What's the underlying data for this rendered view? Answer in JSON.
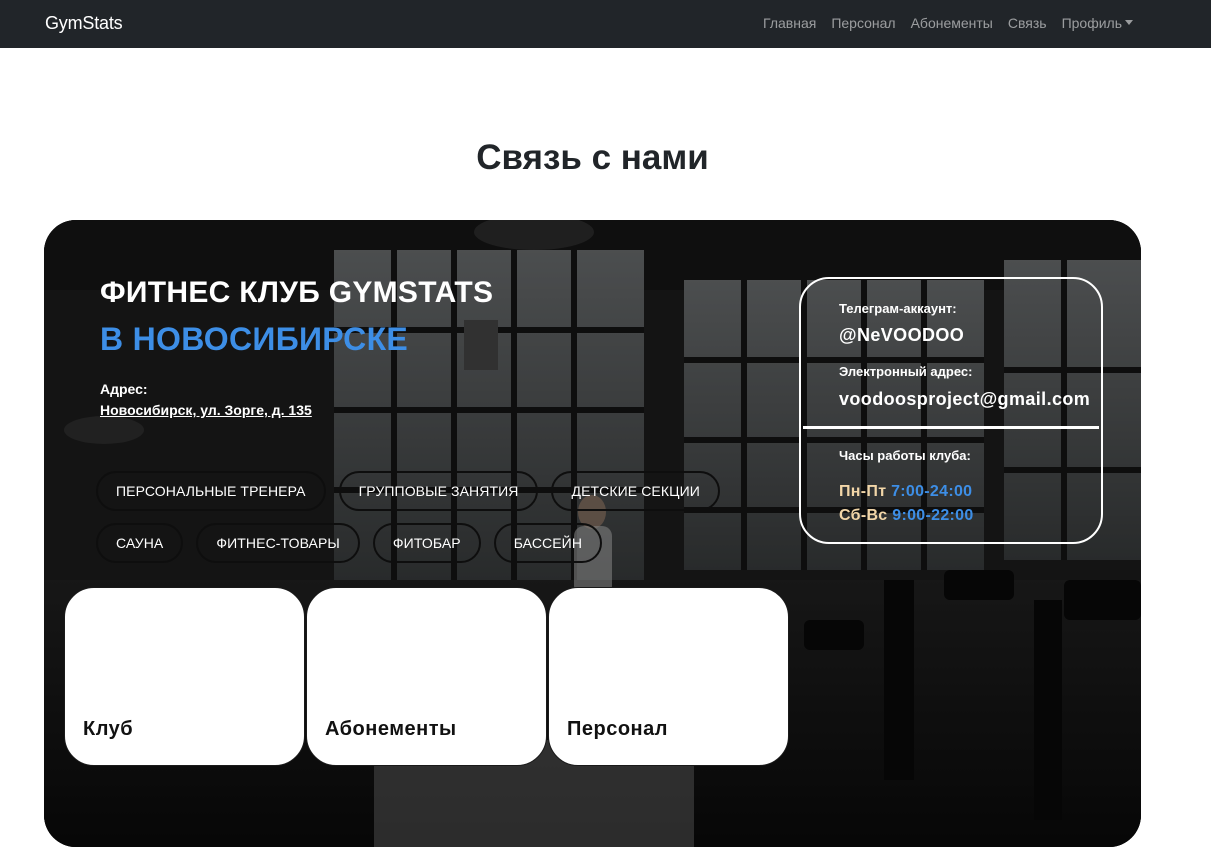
{
  "navbar": {
    "brand": "GymStats",
    "links": [
      "Главная",
      "Персонал",
      "Абонементы",
      "Связь"
    ],
    "profile_label": "Профиль"
  },
  "page": {
    "title": "Связь с нами"
  },
  "club": {
    "title": "ФИТНЕС КЛУБ GYMSTATS",
    "city": "В НОВОСИБИРСКЕ",
    "address_label": "Адрес:",
    "address": "Новосибирск, ул. Зорге, д. 135"
  },
  "services": [
    "Персональные тренера",
    "Групповые занятия",
    "Детские секции",
    "Сауна",
    "Фитнес-товары",
    "Фитобар",
    "Бассейн"
  ],
  "cards": [
    "Клуб",
    "Абонементы",
    "Персонал"
  ],
  "contact": {
    "telegram_label": "Телеграм-аккаунт:",
    "telegram": "@NeVOODOO",
    "email_label": "Электронный адрес:",
    "email": "voodoosproject@gmail.com",
    "hours_label": "Часы работы клуба:",
    "weekdays": "Пн-Пт",
    "weekdays_hours": "7:00-24:00",
    "weekend": "Сб-Вс",
    "weekend_hours": "9:00-22:00"
  },
  "colors": {
    "navbar_bg": "#212529",
    "accent_blue": "#3d8ee6",
    "days_color": "#f2d6a8"
  }
}
